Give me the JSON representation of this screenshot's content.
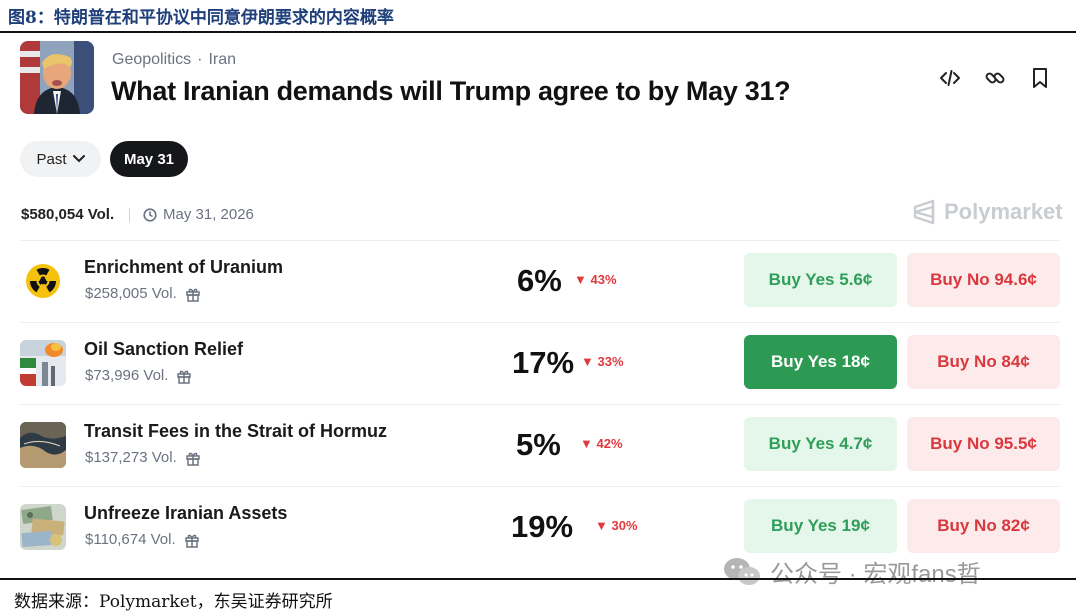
{
  "figure": {
    "caption": "图8：特朗普在和平协议中同意伊朗要求的内容概率",
    "source": "数据来源：Polymarket，东吴证券研究所"
  },
  "market": {
    "category": "Geopolitics",
    "separator": "·",
    "tag": "Iran",
    "title": "What Iranian demands will Trump agree to by May 31?",
    "volume": "$580,054 Vol.",
    "end_date": "May 31, 2026",
    "brand": "Polymarket"
  },
  "filters": {
    "past_label": "Past",
    "selected_label": "May 31"
  },
  "header_icons": [
    "embed-code-icon",
    "link-icon",
    "bookmark-icon"
  ],
  "outcomes": [
    {
      "name": "Enrichment of Uranium",
      "volume": "$258,005 Vol.",
      "probability": "6%",
      "change": "43%",
      "yes_label": "Buy Yes 5.6¢",
      "no_label": "Buy No 94.6¢",
      "yes_active": false
    },
    {
      "name": "Oil Sanction Relief",
      "volume": "$73,996 Vol.",
      "probability": "17%",
      "change": "33%",
      "yes_label": "Buy Yes 18¢",
      "no_label": "Buy No 84¢",
      "yes_active": true
    },
    {
      "name": "Transit Fees in the Strait of Hormuz",
      "volume": "$137,273 Vol.",
      "probability": "5%",
      "change": "42%",
      "yes_label": "Buy Yes 4.7¢",
      "no_label": "Buy No 95.5¢",
      "yes_active": false
    },
    {
      "name": "Unfreeze Iranian Assets",
      "volume": "$110,674 Vol.",
      "probability": "19%",
      "change": "30%",
      "yes_label": "Buy Yes 19¢",
      "no_label": "Buy No 82¢",
      "yes_active": false
    }
  ],
  "colors": {
    "yes_bg": "#e5f6ea",
    "yes_text": "#2f9e5a",
    "yes_active_bg": "#2d9a53",
    "no_bg": "#fdebeb",
    "no_text": "#d9383e",
    "down": "#e0393e",
    "caption": "#1f3f7a"
  },
  "watermark": {
    "text": "公众号 · 宏观fans哲"
  }
}
